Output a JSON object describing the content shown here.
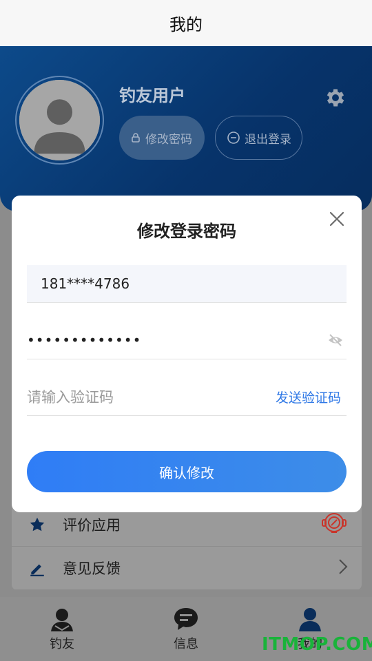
{
  "header": {
    "title": "我的"
  },
  "profile": {
    "username": "钓友用户",
    "change_password_label": "修改密码",
    "logout_label": "退出登录"
  },
  "modal": {
    "title": "修改登录密码",
    "phone_value": "181****4786",
    "password_value": "•••••••••••••",
    "code_placeholder": "请输入验证码",
    "send_code_label": "发送验证码",
    "confirm_label": "确认修改"
  },
  "menu": {
    "items": [
      {
        "label": "评价应用",
        "icon": "star-icon"
      },
      {
        "label": "意见反馈",
        "icon": "pencil-icon"
      }
    ]
  },
  "tabbar": {
    "items": [
      {
        "label": "钓友",
        "icon": "angler-icon"
      },
      {
        "label": "信息",
        "icon": "message-icon"
      },
      {
        "label": "我的",
        "icon": "user-icon"
      }
    ]
  },
  "watermark": {
    "text": "ITMOP.COM"
  },
  "colors": {
    "accent": "#2f78e6",
    "header_blue": "#0b4080",
    "watermark": "#19b33a"
  }
}
